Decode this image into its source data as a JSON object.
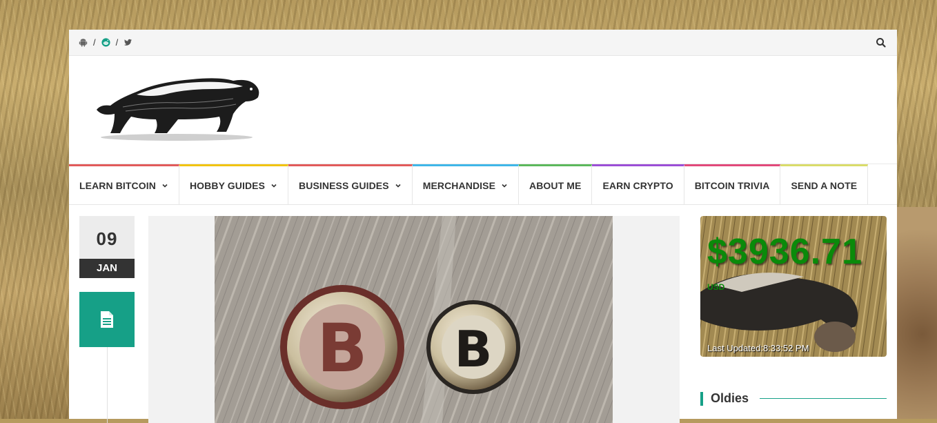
{
  "social": {
    "items": [
      {
        "icon": "android-icon"
      },
      {
        "icon": "reddit-icon",
        "color": "#16a087"
      },
      {
        "icon": "twitter-icon"
      }
    ],
    "separator": "/"
  },
  "search": {
    "icon": "search-icon"
  },
  "logo": {
    "icon": "honey-badger-logo"
  },
  "nav": {
    "items": [
      {
        "label": "LEARN BITCOIN",
        "dropdown": true,
        "color": "#e25b5b"
      },
      {
        "label": "HOBBY GUIDES",
        "dropdown": true,
        "color": "#f1c40f"
      },
      {
        "label": "BUSINESS GUIDES",
        "dropdown": true,
        "color": "#e25b5b"
      },
      {
        "label": "MERCHANDISE",
        "dropdown": true,
        "color": "#3fb6e8"
      },
      {
        "label": "ABOUT ME",
        "dropdown": false,
        "color": "#5cb85c"
      },
      {
        "label": "EARN CRYPTO",
        "dropdown": false,
        "color": "#9b4fd6"
      },
      {
        "label": "BITCOIN TRIVIA",
        "dropdown": false,
        "color": "#e2497a"
      },
      {
        "label": "SEND A NOTE",
        "dropdown": false,
        "color": "#d9dc6a"
      }
    ]
  },
  "post": {
    "day": "09",
    "month": "JAN",
    "format_icon": "document-icon",
    "format_color": "#16a087"
  },
  "price_widget": {
    "price": "$3936.71",
    "currency": "USD",
    "updated": "Last Updated:8:33:52 PM",
    "price_color": "#0a8a0a"
  },
  "sidebar": {
    "section_title": "Oldies"
  }
}
